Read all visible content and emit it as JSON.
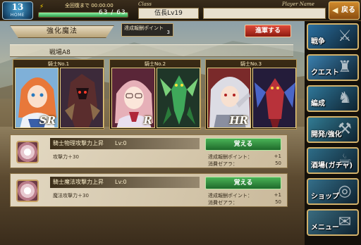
{
  "topbar": {
    "home_number": "13",
    "home_label": "HOME",
    "full_recovery_time": "全回復まで 00:00:00",
    "stamina_count": "63 / 63",
    "stamina_fraction": 1.0,
    "class_label": "Class",
    "rank": "伍長Lv19",
    "player_name_label": "Player Name",
    "back_label": "戻る"
  },
  "header": {
    "title": "強化魔法",
    "points_label": "達成報酬ポイント",
    "points_value": "3",
    "march_label": "進軍する"
  },
  "battle_area": "戦場A8",
  "knights": [
    {
      "label": "騎士No.1",
      "rarity": "SR"
    },
    {
      "label": "騎士No.2",
      "rarity": "R"
    },
    {
      "label": "騎士No.3",
      "rarity": "HR"
    }
  ],
  "skills": [
    {
      "name": "騎士物理攻撃力上昇",
      "level": "Lv:0",
      "effect": "攻撃力＋30",
      "learn_label": "覚える",
      "cost_points_label": "達成報酬ポイント：",
      "cost_points_value": "+1",
      "cost_zeal_label": "消費ゼアラ：",
      "cost_zeal_value": "50"
    },
    {
      "name": "騎士魔法攻撃力上昇",
      "level": "Lv:0",
      "effect": "魔法攻撃力＋30",
      "learn_label": "覚える",
      "cost_points_label": "達成報酬ポイント：",
      "cost_points_value": "+1",
      "cost_zeal_label": "消費ゼアラ：",
      "cost_zeal_value": "50"
    }
  ],
  "side_menu": [
    {
      "label": "戦争",
      "icon": "shield-sword-icon",
      "color": "#2a6fa0"
    },
    {
      "label": "クエスト",
      "icon": "castle-icon",
      "color": "#3a7fae"
    },
    {
      "label": "編成",
      "icon": "helmet-icon",
      "color": "#2f7799"
    },
    {
      "label": "開発/強化",
      "icon": "anvil-icon",
      "color": "#327c94"
    },
    {
      "label": "酒場(ガチャ)",
      "icon": "mug-icon",
      "color": "#2e6d88"
    },
    {
      "label": "ショップ",
      "icon": "coin-bag-icon",
      "color": "#346f8a"
    },
    {
      "label": "メニュー",
      "icon": "scroll-icon",
      "color": "#3a6c80"
    }
  ]
}
